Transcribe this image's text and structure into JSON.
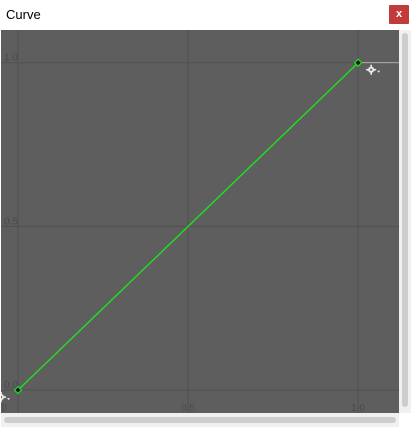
{
  "window": {
    "title": "Curve",
    "close_label": "x"
  },
  "icons": {
    "close": "close-icon",
    "key_settings": "gear-icon"
  },
  "colors": {
    "plot_background": "#5e5e5e",
    "grid_line": "#515151",
    "curve": "#1fe01f",
    "keyframe_fill": "#1a1a1a",
    "close_button": "#c23b3b",
    "scrollbar_track": "#f0f0f0",
    "scrollbar_thumb": "#cdcdcd"
  },
  "chart_data": {
    "type": "line",
    "title": "",
    "xlabel": "",
    "ylabel": "",
    "x_ticks": [
      "0.0",
      "0.5",
      "1.0"
    ],
    "y_ticks": [
      "0.0",
      "0.5",
      "1.0"
    ],
    "x_tick_values": [
      0,
      0.5,
      1
    ],
    "y_tick_values": [
      0,
      0.5,
      1
    ],
    "xlim": [
      -0.05,
      1.12
    ],
    "ylim": [
      -0.07,
      1.1
    ],
    "grid": true,
    "series": [
      {
        "x": [
          0.0,
          1.0
        ],
        "y": [
          0.0,
          1.0
        ]
      }
    ],
    "keyframes": [
      {
        "x": 0.0,
        "y": 0.0
      },
      {
        "x": 1.0,
        "y": 1.0
      }
    ]
  }
}
